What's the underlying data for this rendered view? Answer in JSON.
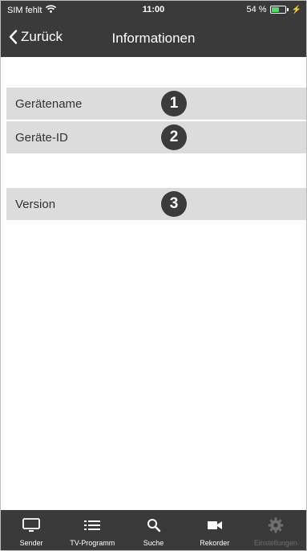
{
  "status_bar": {
    "carrier": "SIM fehlt",
    "time": "11:00",
    "battery": "54 %",
    "battery_level": 0.54,
    "wifi_icon": "wifi-icon",
    "charging_icon": "bolt-icon"
  },
  "navbar": {
    "back_label": "Zurück",
    "title": "Informationen"
  },
  "rows": [
    {
      "label": "Gerätename",
      "badge": "1"
    },
    {
      "label": "Geräte-ID",
      "badge": "2"
    },
    {
      "label": "Version",
      "badge": "3"
    }
  ],
  "tabbar": {
    "items": [
      {
        "label": "Sender",
        "icon": "tv-icon"
      },
      {
        "label": "TV-Programm",
        "icon": "list-icon"
      },
      {
        "label": "Suche",
        "icon": "search-icon"
      },
      {
        "label": "Rekorder",
        "icon": "video-camera-icon"
      },
      {
        "label": "Einstellungen",
        "icon": "gear-icon",
        "active": true
      }
    ]
  },
  "colors": {
    "bar_background": "#3a3a3a",
    "row_background": "#dcdcdc",
    "badge_background": "#3b3b3b",
    "battery_fill": "#4cd964",
    "tab_active": "#6e6e6e"
  }
}
